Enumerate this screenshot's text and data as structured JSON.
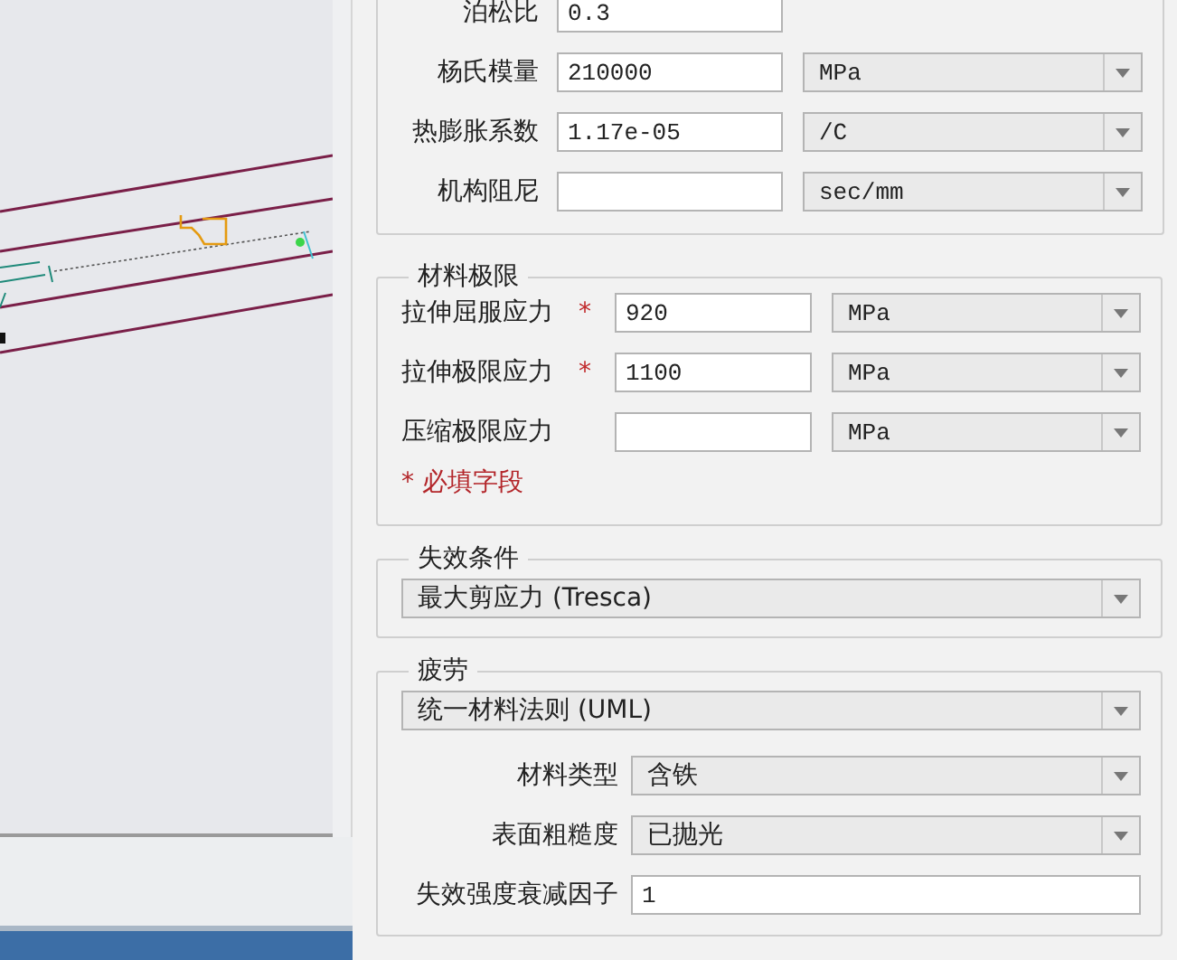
{
  "material_properties": {
    "rows": [
      {
        "label": "泊松比",
        "value": "0.3"
      },
      {
        "label": "杨氏模量",
        "value": "210000",
        "unit": "MPa"
      },
      {
        "label": "热膨胀系数",
        "value": "1.17e-05",
        "unit": "/C"
      },
      {
        "label": "机构阻尼",
        "unit": "sec/mm"
      }
    ]
  },
  "material_limits": {
    "title": "材料极限",
    "rows": [
      {
        "label": "拉伸屈服应力",
        "required_mark": "*",
        "value": "920",
        "unit": "MPa"
      },
      {
        "label": "拉伸极限应力",
        "required_mark": "*",
        "value": "1100",
        "unit": "MPa"
      },
      {
        "label": "压缩极限应力",
        "unit": "MPa"
      }
    ],
    "required_note": "* 必填字段"
  },
  "failure_criterion": {
    "title": "失效条件",
    "value": "最大剪应力 (Tresca)"
  },
  "fatigue": {
    "title": "疲劳",
    "method": "统一材料法则 (UML)",
    "rows": [
      {
        "label": "材料类型",
        "kind": "select",
        "value": "含铁"
      },
      {
        "label": "表面粗糙度",
        "kind": "select",
        "value": "已抛光"
      },
      {
        "label": "失效强度衰减因子",
        "kind": "input",
        "value": "1"
      }
    ]
  }
}
